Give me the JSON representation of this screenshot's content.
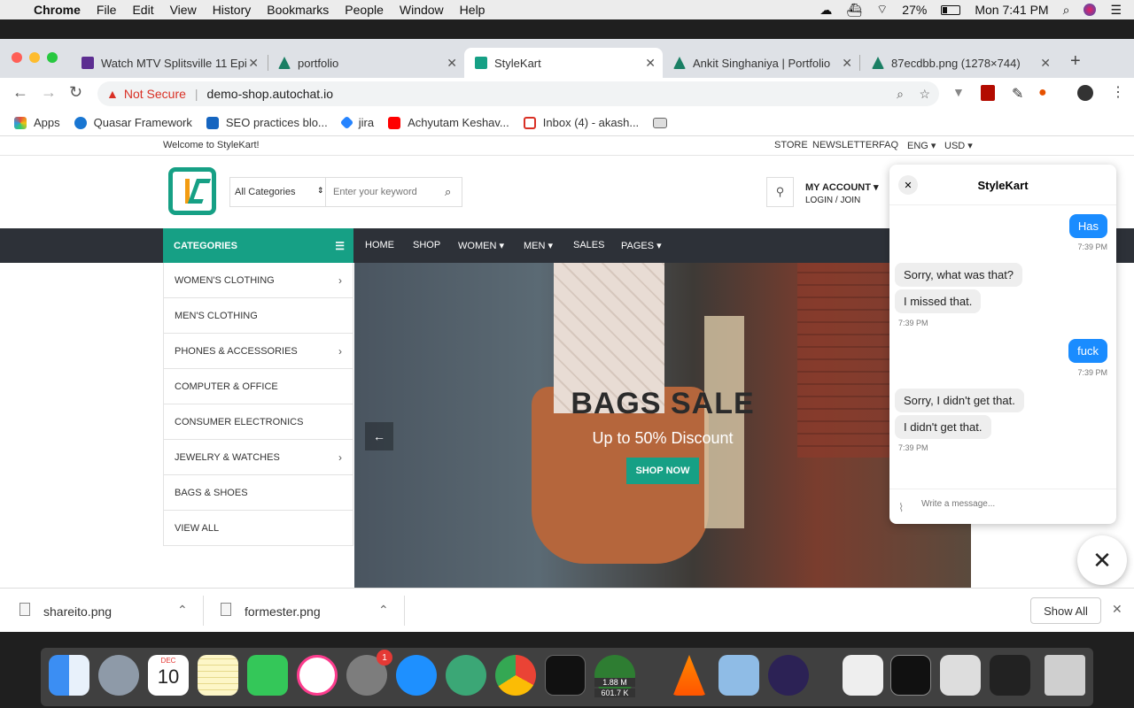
{
  "menubar": {
    "app": "Chrome",
    "items": [
      "File",
      "Edit",
      "View",
      "History",
      "Bookmarks",
      "People",
      "Window",
      "Help"
    ],
    "battery": "27%",
    "clock": "Mon 7:41 PM"
  },
  "tabs": [
    {
      "title": "Watch MTV Splitsville 11 Epi",
      "color": "#5c2d91"
    },
    {
      "title": "portfolio",
      "color": "#1a7f64"
    },
    {
      "title": "StyleKart",
      "color": "#16a085"
    },
    {
      "title": "Ankit Singhaniya | Portfolio",
      "color": "#1a7f64"
    },
    {
      "title": "87ecdbb.png (1278×744)",
      "color": "#1a7f64"
    }
  ],
  "omnibox": {
    "security": "Not Secure",
    "url": "demo-shop.autochat.io"
  },
  "bookmarks": [
    {
      "label": "Apps",
      "color": "#e74c3c"
    },
    {
      "label": "Quasar Framework",
      "color": "#1976d2"
    },
    {
      "label": "SEO practices blo...",
      "color": "#1565c0"
    },
    {
      "label": "jira",
      "color": "#2684ff"
    },
    {
      "label": "Achyutam Keshav...",
      "color": "#ff0000"
    },
    {
      "label": "Inbox (4) - akash...",
      "color": "#d93025"
    }
  ],
  "shop": {
    "welcome": "Welcome to StyleKart!",
    "top_links": [
      "STORE",
      "NEWSLETTER",
      "FAQ",
      "ENG ▾",
      "USD ▾"
    ],
    "search_category": "All Categories",
    "search_placeholder": "Enter your keyword",
    "account_title": "MY ACCOUNT ▾",
    "account_sub": "LOGIN / JOIN",
    "categories_label": "CATEGORIES",
    "nav": [
      "HOME",
      "SHOP",
      "WOMEN ▾",
      "MEN ▾",
      "SALES",
      "PAGES ▾"
    ],
    "categories": [
      {
        "label": "WOMEN'S CLOTHING",
        "chev": "›"
      },
      {
        "label": "MEN'S CLOTHING",
        "chev": ""
      },
      {
        "label": "PHONES & ACCESSORIES",
        "chev": "›"
      },
      {
        "label": "COMPUTER & OFFICE",
        "chev": ""
      },
      {
        "label": "CONSUMER ELECTRONICS",
        "chev": ""
      },
      {
        "label": "JEWELRY & WATCHES",
        "chev": "›"
      },
      {
        "label": "BAGS & SHOES",
        "chev": ""
      },
      {
        "label": "VIEW ALL",
        "chev": ""
      }
    ],
    "hero_title": "BAGS SALE",
    "hero_sub": "Up to 50% Discount",
    "hero_button": "SHOP NOW",
    "accent": "#16a085"
  },
  "chat": {
    "title": "StyleKart",
    "messages": [
      {
        "from": "user",
        "text": "Has",
        "time": "7:39 PM"
      },
      {
        "from": "bot",
        "text": "Sorry, what was that?",
        "time": ""
      },
      {
        "from": "bot",
        "text": "I missed that.",
        "time": "7:39 PM"
      },
      {
        "from": "user",
        "text": "fuck",
        "time": "7:39 PM"
      },
      {
        "from": "bot",
        "text": "Sorry, I didn't get that.",
        "time": ""
      },
      {
        "from": "bot",
        "text": "I didn't get that.",
        "time": "7:39 PM"
      }
    ],
    "input_placeholder": "Write a message..."
  },
  "downloads": {
    "files": [
      "shareito.png",
      "formester.png"
    ],
    "show_all": "Show All"
  },
  "dock": {
    "calendar_month": "DEC",
    "calendar_day": "10",
    "badge": "1",
    "net_up": "1.88 M",
    "net_down": "601.7 K"
  }
}
